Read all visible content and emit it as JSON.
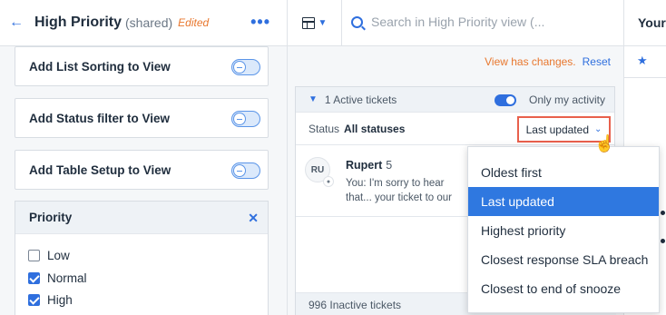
{
  "header": {
    "title": "High Priority",
    "shared": "(shared)",
    "edited": "Edited",
    "more": "•••"
  },
  "settings_cards": [
    {
      "label": "Add List Sorting to View"
    },
    {
      "label": "Add Status filter to View"
    },
    {
      "label": "Add Table Setup to View"
    }
  ],
  "priority": {
    "title": "Priority",
    "options": [
      {
        "label": "Low",
        "checked": false
      },
      {
        "label": "Normal",
        "checked": true
      },
      {
        "label": "High",
        "checked": true
      }
    ]
  },
  "topbar": {
    "search_placeholder": "Search in High Priority view (...",
    "right_label": "Your"
  },
  "changes": {
    "text": "View has changes.",
    "reset": "Reset"
  },
  "tickets": {
    "active_count": "1 Active tickets",
    "only_my_activity": "Only my activity",
    "status_label": "Status",
    "status_value": "All statuses",
    "sort_label": "Last updated",
    "inactive_count": "996 Inactive tickets",
    "items": [
      {
        "initials": "RU",
        "name": "Rupert",
        "number": "5",
        "message": "You: I'm sorry to hear that... your ticket to our Technic..."
      }
    ]
  },
  "sort_menu": {
    "options": [
      "Oldest first",
      "Last updated",
      "Highest priority",
      "Closest response SLA breach",
      "Closest to end of snooze"
    ],
    "selected": "Last updated"
  },
  "colors": {
    "accent": "#2f6fde",
    "edited": "#e8772e",
    "highlight_border": "#e8604c",
    "selected_bg": "#2f78e0"
  }
}
